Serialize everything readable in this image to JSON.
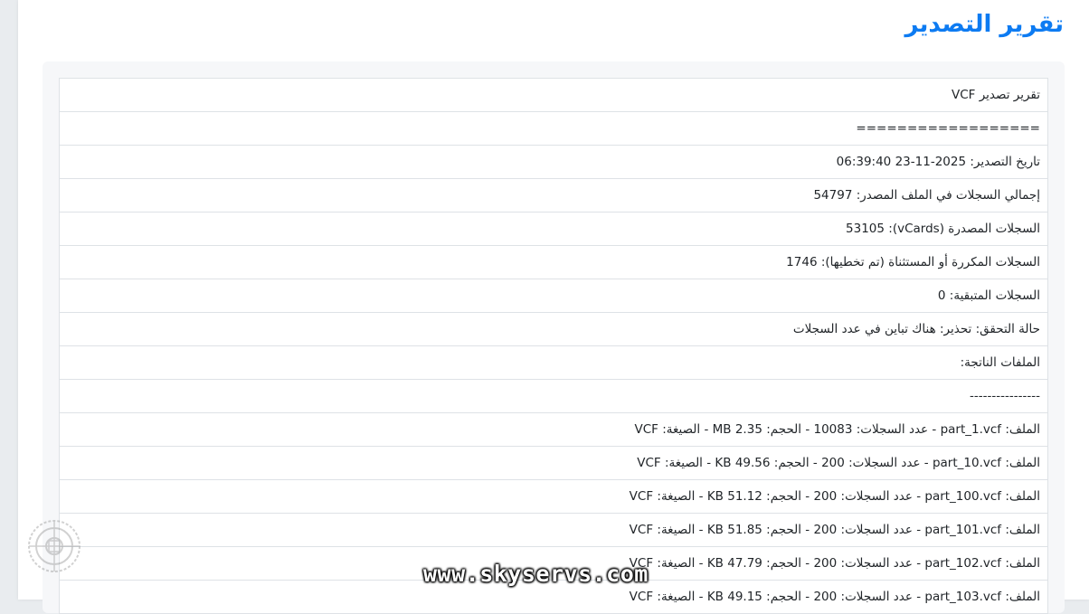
{
  "page": {
    "title": "تقرير التصدير"
  },
  "report": {
    "lines": [
      "تقرير تصدير VCF",
      "==================",
      "تاريخ التصدير: 2025-11-23 06:39:40",
      "إجمالي السجلات في الملف المصدر: 54797",
      "السجلات المصدرة (vCards): 53105",
      "السجلات المكررة أو المستثناة (تم تخطيها): 1746",
      "السجلات المتبقية: 0",
      "حالة التحقق: تحذير: هناك تباين في عدد السجلات",
      "الملفات الناتجة:",
      "----------------",
      "الملف: part_1.vcf - عدد السجلات: 10083 - الحجم: 2.35 MB - الصيغة: VCF",
      "الملف: part_10.vcf - عدد السجلات: 200 - الحجم: 49.56 KB - الصيغة: VCF",
      "الملف: part_100.vcf - عدد السجلات: 200 - الحجم: 51.12 KB - الصيغة: VCF",
      "الملف: part_101.vcf - عدد السجلات: 200 - الحجم: 51.85 KB - الصيغة: VCF",
      "الملف: part_102.vcf - عدد السجلات: 200 - الحجم: 47.79 KB - الصيغة: VCF",
      "الملف: part_103.vcf - عدد السجلات: 200 - الحجم: 49.15 KB - الصيغة: VCF"
    ]
  },
  "watermark": {
    "text": "www.skyservs.com",
    "logo_icon": "gear-seal-icon"
  },
  "colors": {
    "title": "#0d7bf2",
    "border": "#dee2e6",
    "panel": "#f6f7f9"
  }
}
